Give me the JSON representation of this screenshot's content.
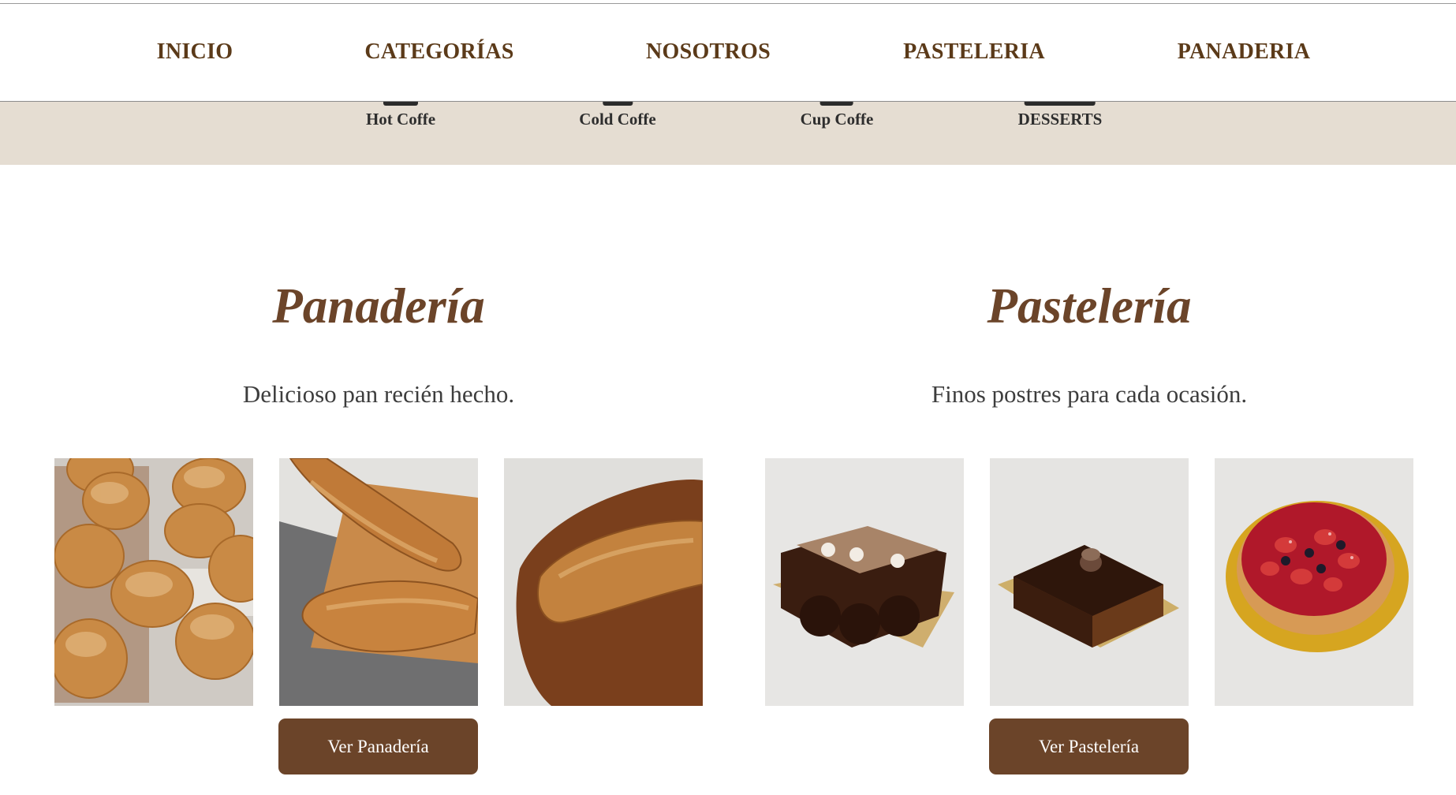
{
  "nav": {
    "items": [
      "INICIO",
      "CATEGORÍAS",
      "NOSOTROS",
      "PASTELERIA",
      "PANADERIA"
    ]
  },
  "categories": {
    "items": [
      {
        "label": "Hot Coffe",
        "icon": "hot-coffee-icon"
      },
      {
        "label": "Cold Coffe",
        "icon": "cold-coffee-icon"
      },
      {
        "label": "Cup Coffe",
        "icon": "cup-coffee-icon"
      },
      {
        "label": "DESSERTS",
        "icon": "desserts-icon"
      }
    ]
  },
  "bakery": {
    "title": "Panadería",
    "subtitle": "Delicioso pan recién hecho.",
    "button_label": "Ver Panadería",
    "photos": [
      "sesame-buns-photo",
      "baguettes-on-board-photo",
      "baguette-wooden-board-photo"
    ]
  },
  "pastry": {
    "title": "Pastelería",
    "subtitle": "Finos postres para cada ocasión.",
    "button_label": "Ver Pastelería",
    "photos": [
      "chocolate-log-cake-photo",
      "chocolate-glazed-cake-photo",
      "berry-tart-photo"
    ]
  },
  "colors": {
    "accent_brown": "#6b4429",
    "nav_text": "#5b3a19",
    "band_bg": "#e5ddd2"
  }
}
